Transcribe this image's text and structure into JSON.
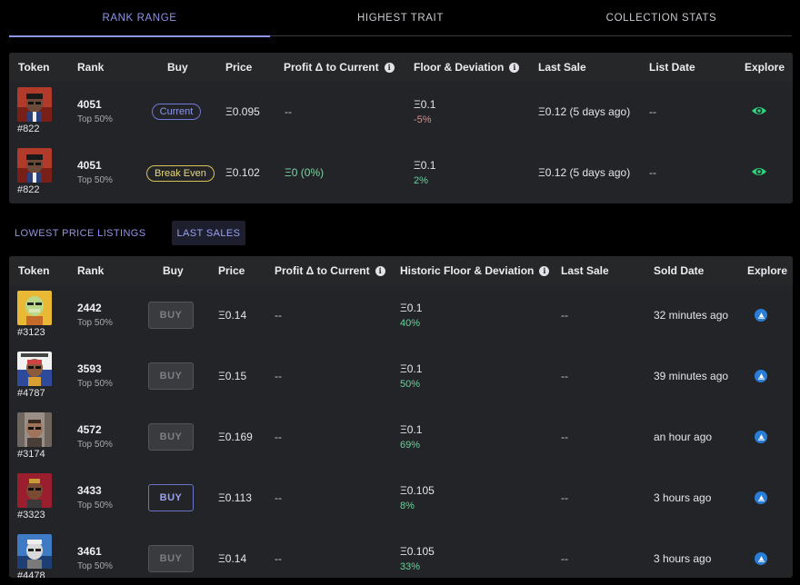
{
  "tabs": [
    "RANK RANGE",
    "HIGHEST TRAIT",
    "COLLECTION STATS"
  ],
  "rank_range_table": {
    "headers": {
      "token": "Token",
      "rank": "Rank",
      "buy": "Buy",
      "price": "Price",
      "profit": "Profit Δ to Current",
      "floor": "Floor & Deviation",
      "last_sale": "Last Sale",
      "list_date": "List Date",
      "explore": "Explore"
    },
    "rows": [
      {
        "id": "#822",
        "rank": "4051",
        "rank_sub": "Top 50%",
        "badge": "Current",
        "price": "Ξ0.095",
        "profit": "--",
        "floor": "Ξ0.1",
        "deviation": "-5%",
        "last_sale": "Ξ0.12 (5 days ago)",
        "list_date": "--"
      },
      {
        "id": "#822",
        "rank": "4051",
        "rank_sub": "Top 50%",
        "badge": "Break Even",
        "price": "Ξ0.102",
        "profit": "Ξ0 (0%)",
        "floor": "Ξ0.1",
        "deviation": "2%",
        "last_sale": "Ξ0.12 (5 days ago)",
        "list_date": "--"
      }
    ]
  },
  "sub_tabs": [
    "LOWEST PRICE LISTINGS",
    "LAST SALES"
  ],
  "sales_table": {
    "headers": {
      "token": "Token",
      "rank": "Rank",
      "buy": "Buy",
      "price": "Price",
      "profit": "Profit Δ to Current",
      "floor": "Historic Floor & Deviation",
      "last_sale": "Last Sale",
      "sold_date": "Sold Date",
      "explore": "Explore"
    },
    "buy_label": "BUY",
    "rows": [
      {
        "id": "#3123",
        "rank": "2442",
        "rank_sub": "Top 50%",
        "price": "Ξ0.14",
        "profit": "--",
        "floor": "Ξ0.1",
        "deviation": "40%",
        "last_sale": "--",
        "sold": "32 minutes ago"
      },
      {
        "id": "#4787",
        "rank": "3593",
        "rank_sub": "Top 50%",
        "price": "Ξ0.15",
        "profit": "--",
        "floor": "Ξ0.1",
        "deviation": "50%",
        "last_sale": "--",
        "sold": "39 minutes ago"
      },
      {
        "id": "#3174",
        "rank": "4572",
        "rank_sub": "Top 50%",
        "price": "Ξ0.169",
        "profit": "--",
        "floor": "Ξ0.1",
        "deviation": "69%",
        "last_sale": "--",
        "sold": "an hour ago"
      },
      {
        "id": "#3323",
        "rank": "3433",
        "rank_sub": "Top 50%",
        "price": "Ξ0.113",
        "profit": "--",
        "floor": "Ξ0.105",
        "deviation": "8%",
        "last_sale": "--",
        "sold": "3 hours ago"
      },
      {
        "id": "#4478",
        "rank": "3461",
        "rank_sub": "Top 50%",
        "price": "Ξ0.14",
        "profit": "--",
        "floor": "Ξ0.105",
        "deviation": "33%",
        "last_sale": "--",
        "sold": "3 hours ago"
      }
    ]
  },
  "colors": {
    "accent": "#8f95e8",
    "positive": "#66d49a",
    "negative": "#e08a86",
    "current_badge": "#8f97ea",
    "break_even_badge": "#e8d77d",
    "explore_icon": "#2bd47e",
    "explore_round": "#2a7dd6"
  },
  "icons": {
    "info": "info-icon",
    "eye": "eye-icon",
    "explore": "opensea-icon"
  }
}
